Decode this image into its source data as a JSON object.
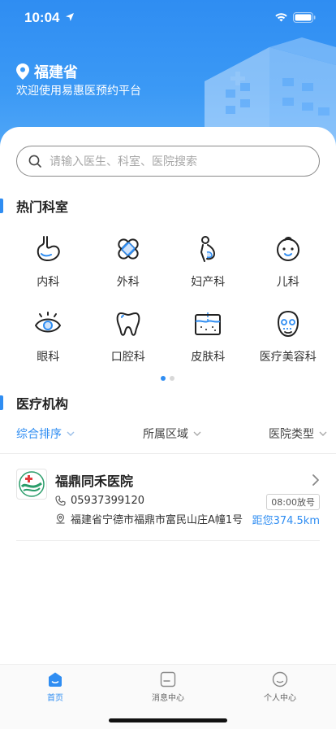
{
  "status_bar": {
    "time": "10:04"
  },
  "header": {
    "region": "福建省",
    "welcome": "欢迎使用易惠医预约平台",
    "accent_color": "#2f8df2"
  },
  "search": {
    "placeholder": "请输入医生、科室、医院搜索",
    "icon": "search-icon"
  },
  "departments_section": {
    "title": "热门科室",
    "items": [
      {
        "label": "内科",
        "icon": "stomach-icon"
      },
      {
        "label": "外科",
        "icon": "bandage-icon"
      },
      {
        "label": "妇产科",
        "icon": "pregnant-icon"
      },
      {
        "label": "儿科",
        "icon": "baby-face-icon"
      },
      {
        "label": "眼科",
        "icon": "eye-icon"
      },
      {
        "label": "口腔科",
        "icon": "tooth-icon"
      },
      {
        "label": "皮肤科",
        "icon": "skin-icon"
      },
      {
        "label": "医疗美容科",
        "icon": "beauty-face-icon"
      }
    ],
    "page_index": 1,
    "page_count": 2
  },
  "institutions_section": {
    "title": "医疗机构",
    "filters": [
      {
        "label": "综合排序",
        "active": true
      },
      {
        "label": "所属区域",
        "active": false
      },
      {
        "label": "医院类型",
        "active": false
      }
    ],
    "hospitals": [
      {
        "name": "福鼎同禾医院",
        "phone": "05937399120",
        "address": "福建省宁德市福鼎市富民山庄A幢1号",
        "release_time": "08:00放号",
        "distance": "距您374.5km"
      }
    ]
  },
  "tabbar": {
    "tabs": [
      {
        "label": "首页",
        "icon": "home-icon",
        "active": true
      },
      {
        "label": "消息中心",
        "icon": "message-icon",
        "active": false
      },
      {
        "label": "个人中心",
        "icon": "profile-icon",
        "active": false
      }
    ]
  }
}
